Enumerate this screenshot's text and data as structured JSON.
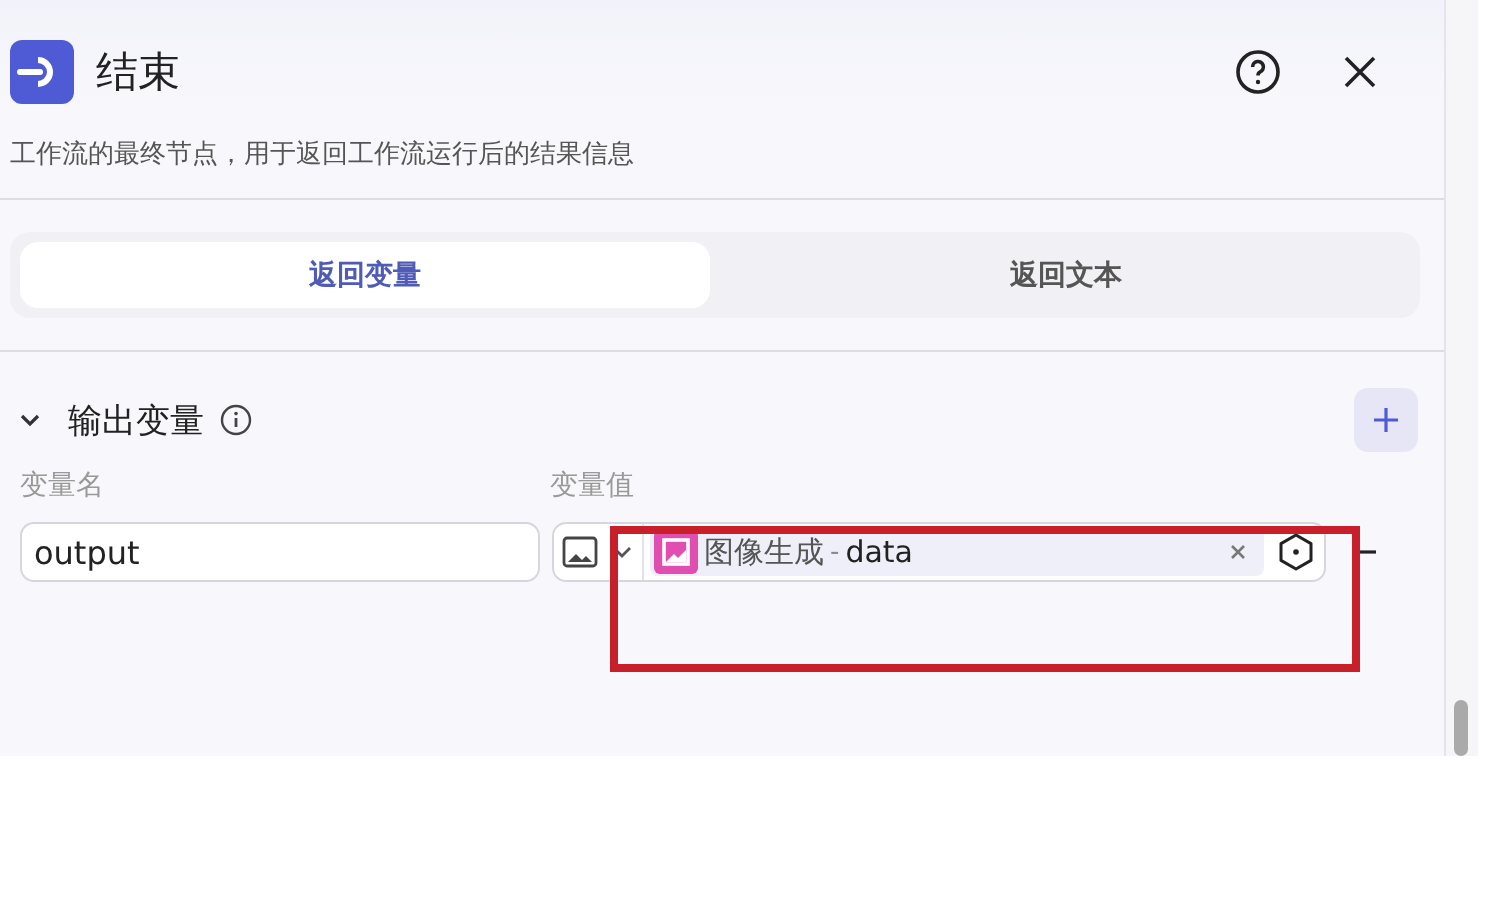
{
  "panel": {
    "title": "结束",
    "description": "工作流的最终节点，用于返回工作流运行后的结果信息"
  },
  "tabs": [
    {
      "label": "返回变量",
      "selected": true
    },
    {
      "label": "返回文本",
      "selected": false
    }
  ],
  "output_section": {
    "title": "输出变量",
    "expanded": true,
    "columns": [
      "变量名",
      "变量值"
    ],
    "rows": [
      {
        "name": "output",
        "reference": {
          "node": "图像生成",
          "separator": "-",
          "field": "data"
        }
      }
    ]
  }
}
